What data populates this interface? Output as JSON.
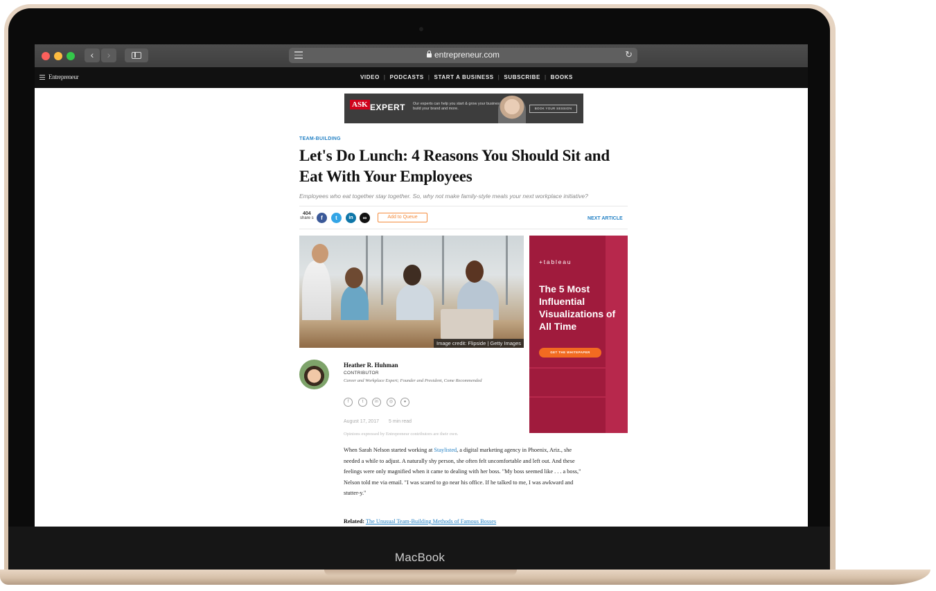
{
  "device": {
    "label": "MacBook"
  },
  "browser": {
    "url": "entrepreneur.com",
    "back_label": "‹",
    "forward_label": "›",
    "reload_label": "↻"
  },
  "site": {
    "logo": "Entrepreneur",
    "nav": [
      "VIDEO",
      "PODCASTS",
      "START A BUSINESS",
      "SUBSCRIBE",
      "BOOKS"
    ]
  },
  "top_ad": {
    "ask": "ASK",
    "expert": "EXPERT",
    "copy": "Our experts can help you start & grow your business, build your brand and more.",
    "cta": "BOOK YOUR SESSION"
  },
  "article": {
    "category": "TEAM-BUILDING",
    "headline": "Let's Do Lunch: 4 Reasons You Should Sit and Eat With Your Employees",
    "subhead": "Employees who eat together stay together. So, why not make family-style meals your next workplace initiative?",
    "share_count": "404",
    "share_label": "share s",
    "queue_label": "Add to Queue",
    "next_article": "NEXT ARTICLE",
    "image_credit": "Image credit: Flipside | Getty Images",
    "author": {
      "name": "Heather R. Huhman",
      "role": "CONTRIBUTOR",
      "bio": "Career and Workplace Expert; Founder and President, Come Recommended"
    },
    "date": "August 17, 2017",
    "read_time": "5 min read",
    "disclaimer": "Opinions expressed by Entrepreneur contributors are their own.",
    "body_before_link": "When Sarah Nelson started working at ",
    "body_link": "Staylisted",
    "body_after_link": ", a digital marketing agency in Phoenix, Ariz., she needed a while to adjust. A naturally shy person, she often felt uncomfortable and left out. And these feelings were only magnified when it came to dealing with her boss. \"My boss seemed like . . . a boss,\" Nelson told me via email. \"I was scared to go near his office. If he talked to me, I was awkward and stutter-y.\"",
    "related_label": "Related:",
    "related_link": "The Unusual Team-Building Methods of Famous Bosses"
  },
  "side_ad": {
    "brand": "+tableau",
    "headline": "The 5 Most Influential Visualizations of All Time",
    "cta": "GET THE WHITEPAPER"
  },
  "colors": {
    "accent_blue": "#2582c5",
    "ad_red": "#a01b3d",
    "queue_orange": "#f48a3a"
  }
}
